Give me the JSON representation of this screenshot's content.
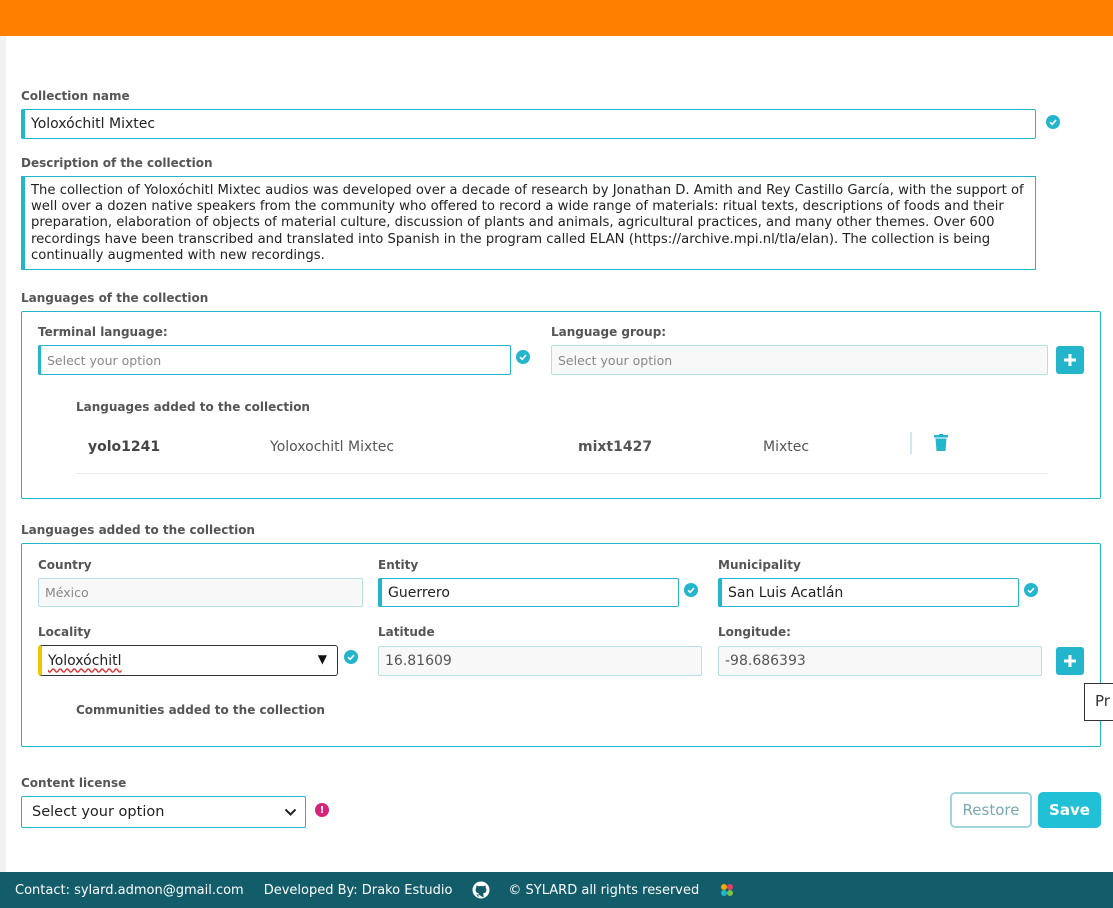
{
  "collection_name": {
    "label": "Collection name",
    "value": "Yoloxóchitl Mixtec"
  },
  "description": {
    "label": "Description of the collection",
    "value": "The collection of Yoloxóchitl Mixtec audios was developed over a decade of research by Jonathan D. Amith and Rey Castillo García, with the support of well over a dozen native speakers from the community who offered to record a wide range of materials: ritual texts, descriptions of foods and their preparation, elaboration of objects of material culture, discussion of plants and animals, agricultural practices, and many other themes. Over 600 recordings have been transcribed and translated into Spanish in the program called ELAN (https://archive.mpi.nl/tla/elan). The collection is being continually augmented with new recordings."
  },
  "languages_section": {
    "label": "Languages of the collection",
    "terminal_label": "Terminal language:",
    "terminal_placeholder": "Select your option",
    "group_label": "Language group:",
    "group_placeholder": "Select your option",
    "added_label": "Languages added to the collection",
    "rows": [
      {
        "code": "yolo1241",
        "name": "Yoloxochitl Mixtec",
        "group_code": "mixt1427",
        "group_name": "Mixtec"
      }
    ]
  },
  "locations_section": {
    "label": "Languages added to the collection",
    "country_label": "Country",
    "country_value": "México",
    "entity_label": "Entity",
    "entity_value": "Guerrero",
    "municipality_label": "Municipality",
    "municipality_value": "San Luis Acatlán",
    "locality_label": "Locality",
    "locality_value": "Yoloxóchitl",
    "latitude_label": "Latitude",
    "latitude_value": "16.81609",
    "longitude_label": "Longitude:",
    "longitude_value": "-98.686393",
    "communities_label": "Communities added to the collection"
  },
  "license": {
    "label": "Content license",
    "value": "Select your option"
  },
  "buttons": {
    "restore": "Restore",
    "save": "Save"
  },
  "tooltip": "Pr",
  "footer": {
    "contact": "Contact: sylard.admon@gmail.com",
    "developed": "Developed By: Drako Estudio",
    "rights": "© SYLARD all rights reserved"
  },
  "colors": {
    "accent": "#22b5cc",
    "topbar": "#ff7f00",
    "footer": "#135c6a",
    "warning": "#d6247a"
  }
}
